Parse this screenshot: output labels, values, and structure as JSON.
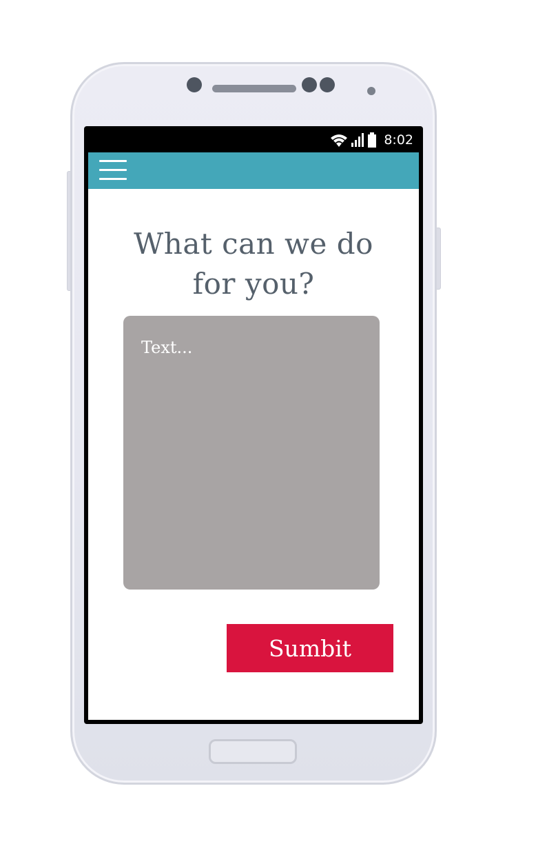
{
  "status_bar": {
    "time": "8:02",
    "icons": [
      "wifi-icon",
      "signal-icon",
      "battery-icon"
    ]
  },
  "app_bar": {
    "menu_icon": "hamburger-menu-icon",
    "color": "#44a7b9"
  },
  "main": {
    "title_line1": "What can we do",
    "title_line2": "for you?",
    "message_placeholder": "Text...",
    "message_value": "",
    "submit_label": "Sumbit"
  },
  "colors": {
    "title_text": "#55606b",
    "input_bg": "#a8a4a4",
    "submit_bg": "#d9143e"
  }
}
